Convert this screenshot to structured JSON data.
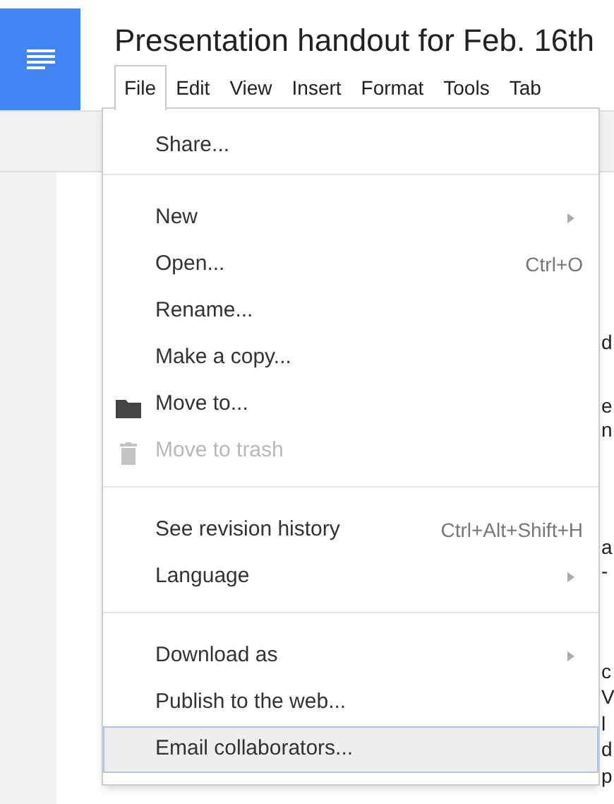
{
  "title": "Presentation handout for Feb. 16th",
  "menubar": [
    {
      "label": "File",
      "selected": true
    },
    {
      "label": "Edit",
      "selected": false
    },
    {
      "label": "View",
      "selected": false
    },
    {
      "label": "Insert",
      "selected": false
    },
    {
      "label": "Format",
      "selected": false
    },
    {
      "label": "Tools",
      "selected": false
    },
    {
      "label": "Tab",
      "selected": false
    }
  ],
  "document_fragments": [
    "d",
    "e",
    "n",
    "a",
    "-",
    "c",
    "V",
    "l",
    "d",
    "p"
  ],
  "file_menu": [
    {
      "kind": "group",
      "items": [
        {
          "label": "Share...",
          "disabled": false,
          "selected": false
        }
      ]
    },
    {
      "kind": "group",
      "items": [
        {
          "label": "New",
          "kind": "submenu",
          "disabled": false,
          "selected": false
        },
        {
          "label": "Open...",
          "shortcut": "Ctrl+O",
          "disabled": false,
          "selected": false
        },
        {
          "label": "Rename...",
          "disabled": false,
          "selected": false
        },
        {
          "label": "Make a copy...",
          "disabled": false,
          "selected": false
        },
        {
          "label": "Move to...",
          "kind": "folder",
          "disabled": false,
          "selected": false
        },
        {
          "label": "Move to trash",
          "kind": "trash",
          "disabled": true,
          "selected": false
        }
      ]
    },
    {
      "kind": "group",
      "items": [
        {
          "label": "See revision history",
          "shortcut": "Ctrl+Alt+Shift+H",
          "disabled": false,
          "selected": false
        },
        {
          "label": "Language",
          "kind": "submenu",
          "disabled": false,
          "selected": false
        }
      ]
    },
    {
      "kind": "group",
      "items": [
        {
          "label": "Download as",
          "kind": "submenu",
          "disabled": false,
          "selected": false
        },
        {
          "label": "Publish to the web...",
          "disabled": false,
          "selected": false
        },
        {
          "label": "Email collaborators...",
          "disabled": false,
          "selected": true
        }
      ]
    }
  ]
}
